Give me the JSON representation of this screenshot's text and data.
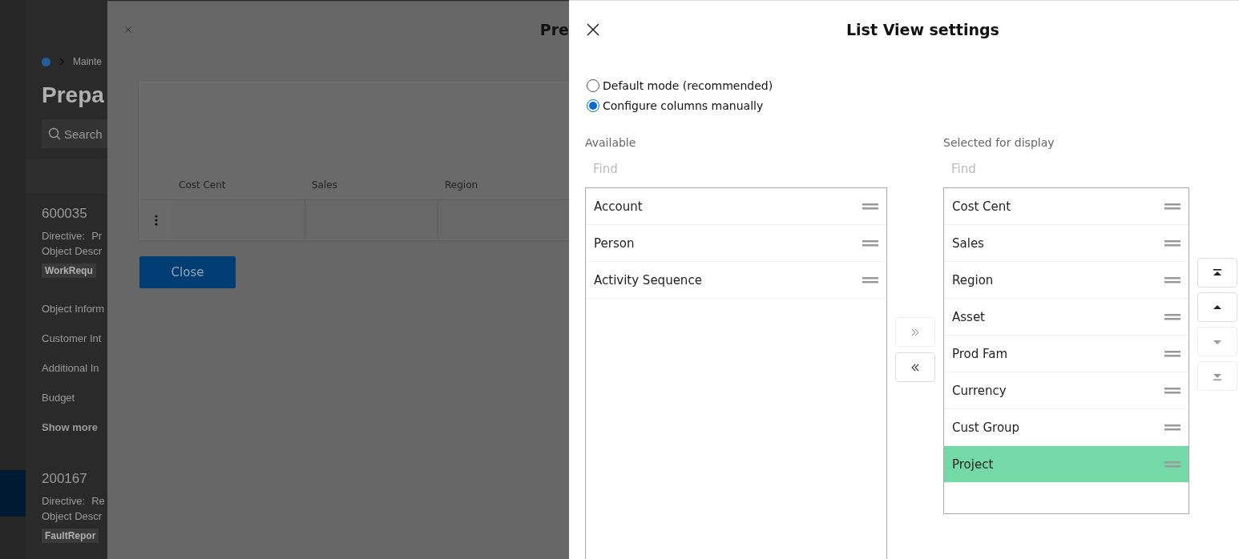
{
  "background_page": {
    "nav": [
      {
        "selected": true
      }
    ],
    "breadcrumb": "Mainte",
    "title": "Prepa",
    "search": {
      "placeholder": "Search"
    },
    "records": [
      {
        "number": "600035",
        "directive_label": "Directive:",
        "directive_value": "Pr",
        "object_label": "Object Descr",
        "tag": "WorkRequ"
      },
      {
        "number": "200167",
        "directive_label": "Directive:",
        "directive_value": "Re",
        "object_label": "Object Descr",
        "tag": "FaultRepor"
      }
    ],
    "sections": [
      "Object Inform",
      "Customer Int",
      "Additional In",
      "Budget"
    ],
    "show_more": "Show more"
  },
  "dialog": {
    "title": "Pre",
    "table": {
      "columns": [
        "Cost Cent",
        "Sales",
        "Region"
      ]
    },
    "close_button": "Close"
  },
  "settings_panel": {
    "title": "List View settings",
    "modes": [
      {
        "label": "Default mode (recommended)",
        "selected": false
      },
      {
        "label": "Configure columns manually",
        "selected": true
      }
    ],
    "available": {
      "label": "Available",
      "placeholder": "Find",
      "items": [
        {
          "label": "Account",
          "selected": false
        },
        {
          "label": "Person",
          "selected": false
        },
        {
          "label": "Activity Sequence",
          "selected": false
        }
      ]
    },
    "transfer_buttons": [
      {
        "kind": "add",
        "disabled": true
      },
      {
        "kind": "remove",
        "disabled": false
      }
    ],
    "selected": {
      "label": "Selected for display",
      "placeholder": "Find",
      "items": [
        {
          "label": "Cost Cent",
          "selected": false
        },
        {
          "label": "Sales",
          "selected": false
        },
        {
          "label": "Region",
          "selected": false
        },
        {
          "label": "Asset",
          "selected": false
        },
        {
          "label": "Prod Fam",
          "selected": false
        },
        {
          "label": "Currency",
          "selected": false
        },
        {
          "label": "Cust Group",
          "selected": false
        },
        {
          "label": "Project",
          "selected": true
        }
      ]
    },
    "order_buttons": [
      {
        "kind": "top",
        "disabled": false
      },
      {
        "kind": "up",
        "disabled": false
      },
      {
        "kind": "down",
        "disabled": true
      },
      {
        "kind": "bottom",
        "disabled": true
      }
    ]
  }
}
